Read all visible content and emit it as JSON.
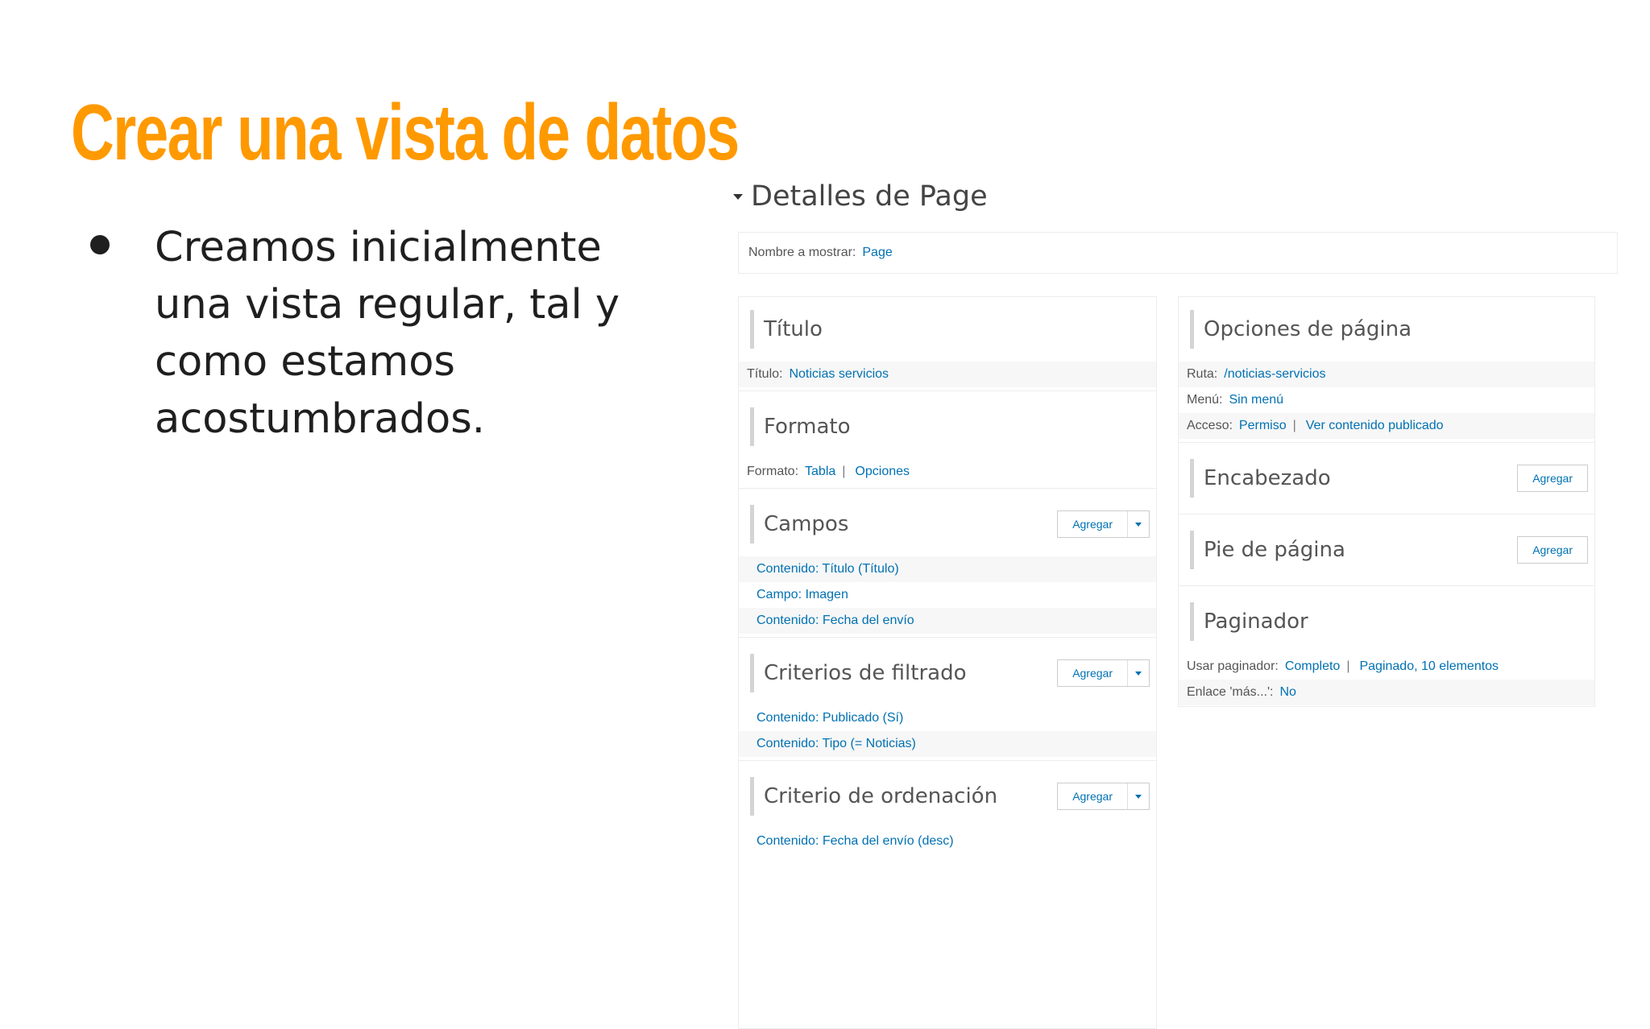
{
  "slide": {
    "title": "Crear una vista de datos",
    "bullet": "Creamos inicialmente una vista regular, tal y como estamos acostumbrados."
  },
  "details": {
    "heading": "Detalles de Page",
    "display_name_label": "Nombre a mostrar:",
    "display_name_value": "Page"
  },
  "left_column": {
    "title": {
      "heading": "Título",
      "label": "Título:",
      "value": "Noticias servicios"
    },
    "format": {
      "heading": "Formato",
      "label": "Formato:",
      "value": "Tabla",
      "separator": "|",
      "options": "Opciones"
    },
    "fields": {
      "heading": "Campos",
      "add_label": "Agregar",
      "items": [
        "Contenido: Título (Título)",
        "Campo: Imagen",
        "Contenido: Fecha del envío"
      ]
    },
    "filters": {
      "heading": "Criterios de filtrado",
      "add_label": "Agregar",
      "items": [
        "Contenido: Publicado (Sí)",
        "Contenido: Tipo (= Noticias)"
      ]
    },
    "sort": {
      "heading": "Criterio de ordenación",
      "add_label": "Agregar",
      "items": [
        "Contenido: Fecha del envío (desc)"
      ]
    }
  },
  "right_column": {
    "page_options": {
      "heading": "Opciones de página",
      "path_label": "Ruta:",
      "path_value": "/noticias-servicios",
      "menu_label": "Menú:",
      "menu_value": "Sin menú",
      "access_label": "Acceso:",
      "access_value": "Permiso",
      "separator": "|",
      "access_extra": "Ver contenido publicado"
    },
    "header": {
      "heading": "Encabezado",
      "add_label": "Agregar"
    },
    "footer": {
      "heading": "Pie de página",
      "add_label": "Agregar"
    },
    "pager": {
      "heading": "Paginador",
      "use_label": "Usar paginador:",
      "use_value": "Completo",
      "separator": "|",
      "use_extra": "Paginado, 10 elementos",
      "more_label": "Enlace 'más...':",
      "more_value": "No"
    }
  },
  "colors": {
    "title": "#ff9900",
    "link": "#0071b3",
    "text": "#1f1f1f"
  }
}
